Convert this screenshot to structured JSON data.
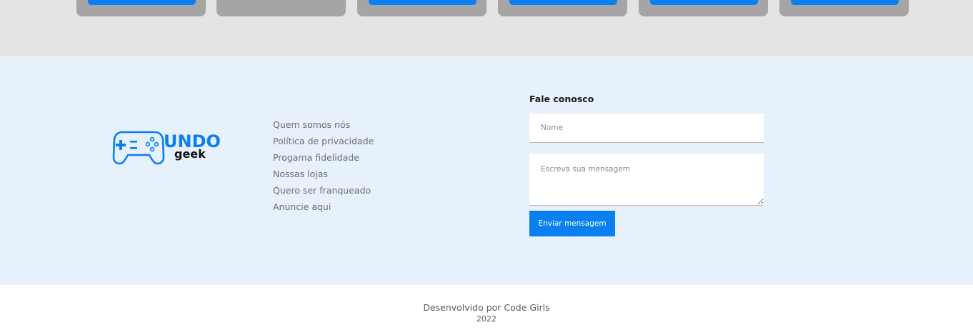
{
  "top_cards": [
    {
      "has_button": true
    },
    {
      "has_button": false
    },
    {
      "has_button": true
    },
    {
      "has_button": true
    },
    {
      "has_button": true
    },
    {
      "has_button": true
    }
  ],
  "logo": {
    "word": "UNDO",
    "sub": "geek",
    "icon": "gamepad-icon"
  },
  "footer_links": [
    "Quem somos nós",
    "Política de privacidade",
    "Progama fidelidade",
    "Nossas lojas",
    "Quero ser franqueado",
    "Anuncie aqui"
  ],
  "contact": {
    "title": "Fale conosco",
    "name_placeholder": "Nome",
    "message_placeholder": "Escreva sua mensagem",
    "send_label": "Enviar mensagem"
  },
  "credits": {
    "line1": "Desenvolvido por Code Girls",
    "line2": "2022"
  },
  "colors": {
    "accent": "#0a7ff0",
    "footer_bg": "#e6f1fc",
    "strip_bg": "#e4e4e4",
    "card_bg": "#a5a5a5"
  }
}
